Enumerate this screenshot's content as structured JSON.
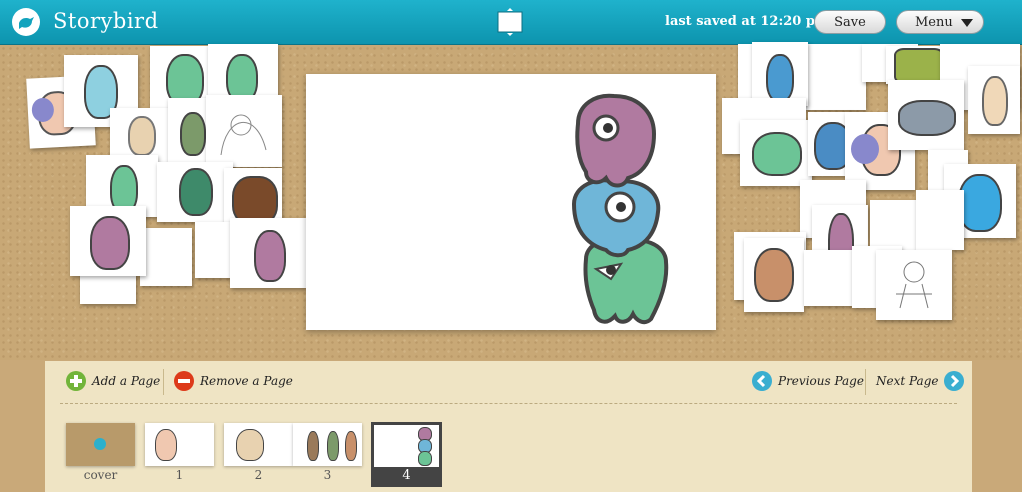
{
  "header": {
    "brand": "Storybird",
    "last_saved": "last saved at 12:20 pm",
    "save_label": "Save",
    "menu_label": "Menu"
  },
  "toolbar": {
    "add_page": "Add a Page",
    "remove_page": "Remove a Page",
    "previous_page": "Previous Page",
    "next_page": "Next Page"
  },
  "pages": [
    {
      "label": "cover"
    },
    {
      "label": "1"
    },
    {
      "label": "2"
    },
    {
      "label": "3"
    },
    {
      "label": "4",
      "selected": true
    }
  ],
  "colors": {
    "topbar": "#12a3bd",
    "cork": "#c8a876",
    "panel": "#efe4c4",
    "monster_pink": "#b07aa0",
    "monster_blue": "#6fb6d8",
    "monster_green": "#6cc496"
  }
}
